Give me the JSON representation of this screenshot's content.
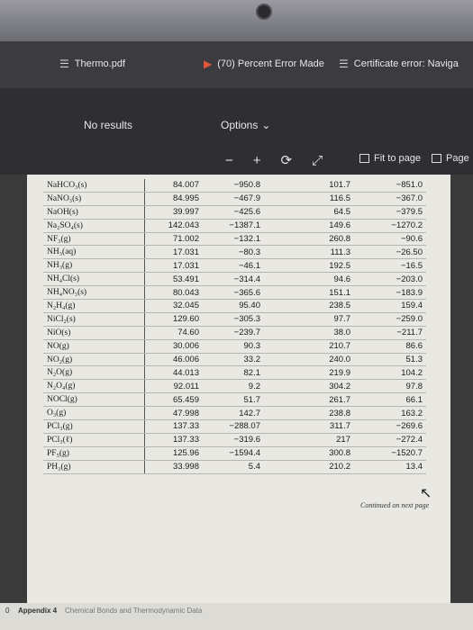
{
  "tabs": [
    {
      "label": "Thermo.pdf",
      "icon": "page-icon"
    },
    {
      "label": "(70) Percent Error Made",
      "icon": "youtube-icon"
    },
    {
      "label": "Certificate error: Naviga",
      "icon": "page-icon"
    }
  ],
  "toolbar": {
    "search_status": "No results",
    "options_label": "Options",
    "fit_label": "Fit to page",
    "page_label": "Page"
  },
  "table": {
    "rows": [
      [
        "NaHCO₃(s)",
        "84.007",
        "−950.8",
        "101.7",
        "−851.0"
      ],
      [
        "NaNO₃(s)",
        "84.995",
        "−467.9",
        "116.5",
        "−367.0"
      ],
      [
        "NaOH(s)",
        "39.997",
        "−425.6",
        "64.5",
        "−379.5"
      ],
      [
        "Na₂SO₄(s)",
        "142.043",
        "−1387.1",
        "149.6",
        "−1270.2"
      ],
      [
        "NF₃(g)",
        "71.002",
        "−132.1",
        "260.8",
        "−90.6"
      ],
      [
        "NH₃(aq)",
        "17.031",
        "−80.3",
        "111.3",
        "−26.50"
      ],
      [
        "NH₃(g)",
        "17.031",
        "−46.1",
        "192.5",
        "−16.5"
      ],
      [
        "NH₄Cl(s)",
        "53.491",
        "−314.4",
        "94.6",
        "−203.0"
      ],
      [
        "NH₄NO₃(s)",
        "80.043",
        "−365.6",
        "151.1",
        "−183.9"
      ],
      [
        "N₂H₄(g)",
        "32.045",
        "95.40",
        "238.5",
        "159.4"
      ],
      [
        "NiCl₂(s)",
        "129.60",
        "−305.3",
        "97.7",
        "−259.0"
      ],
      [
        "NiO(s)",
        "74.60",
        "−239.7",
        "38.0",
        "−211.7"
      ],
      [
        "NO(g)",
        "30.006",
        "90.3",
        "210.7",
        "86.6"
      ],
      [
        "NO₂(g)",
        "46.006",
        "33.2",
        "240.0",
        "51.3"
      ],
      [
        "N₂O(g)",
        "44.013",
        "82.1",
        "219.9",
        "104.2"
      ],
      [
        "N₂O₄(g)",
        "92.011",
        "9.2",
        "304.2",
        "97.8"
      ],
      [
        "NOCl(g)",
        "65.459",
        "51.7",
        "261.7",
        "66.1"
      ],
      [
        "O₃(g)",
        "47.998",
        "142.7",
        "238.8",
        "163.2"
      ],
      [
        "PCl₃(g)",
        "137.33",
        "−288.07",
        "311.7",
        "−269.6"
      ],
      [
        "PCl₃(ℓ)",
        "137.33",
        "−319.6",
        "217",
        "−272.4"
      ],
      [
        "PF₅(g)",
        "125.96",
        "−1594.4",
        "300.8",
        "−1520.7"
      ],
      [
        "PH₃(g)",
        "33.998",
        "5.4",
        "210.2",
        "13.4"
      ]
    ],
    "continued_note": "Continued on next page"
  },
  "footer": {
    "page_number": "0",
    "label": "Appendix 4",
    "subtitle": "Chemical Bonds and Thermodynamic Data"
  }
}
